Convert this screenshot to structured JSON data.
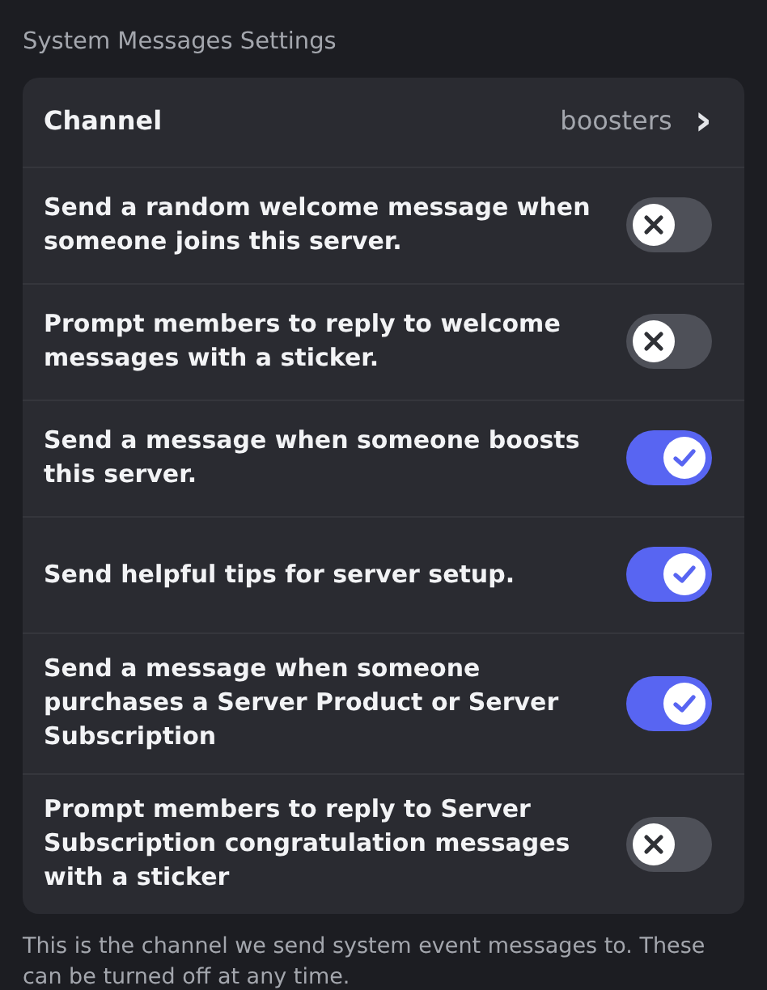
{
  "section_title": "System Messages Settings",
  "channel": {
    "label": "Channel",
    "value": "boosters",
    "chevron": "›"
  },
  "settings": [
    {
      "label": "Send a random welcome message when someone joins this server.",
      "on": false
    },
    {
      "label": "Prompt members to reply to welcome messages with a sticker.",
      "on": false
    },
    {
      "label": "Send a message when someone boosts this server.",
      "on": true
    },
    {
      "label": "Send helpful tips for server setup.",
      "on": true
    },
    {
      "label": "Send a message when someone purchases a Server Product or Server Subscription",
      "on": true
    },
    {
      "label": "Prompt members to reply to Server Subscription congratulation messages with a sticker",
      "on": false
    }
  ],
  "footer": "This is the channel we send system event messages to. These can be turned off at any time."
}
